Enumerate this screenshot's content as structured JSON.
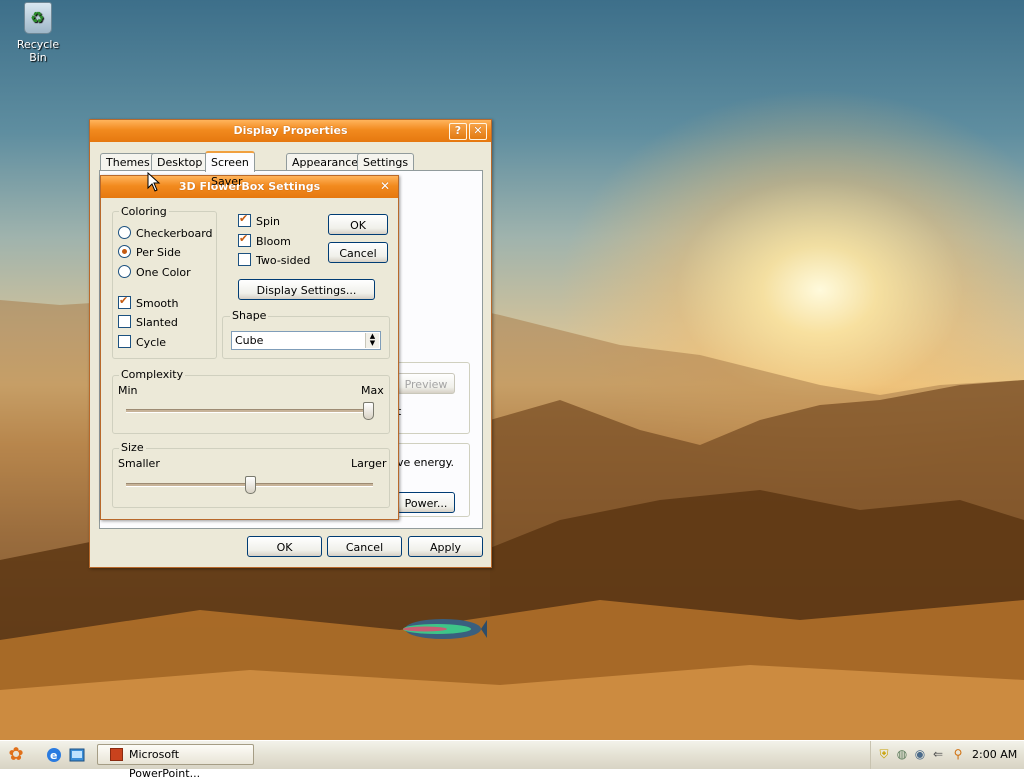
{
  "desktop": {
    "icons": [
      {
        "label": "Recycle Bin"
      }
    ]
  },
  "display_properties": {
    "title": "Display Properties",
    "tabs": [
      {
        "label": "Themes"
      },
      {
        "label": "Desktop"
      },
      {
        "label": "Screen Saver",
        "active": true
      },
      {
        "label": "Appearance"
      },
      {
        "label": "Settings"
      }
    ],
    "partial_preview_label": "Preview",
    "partial_text_energy": "ve energy.",
    "partial_text_t": "t",
    "power_button": "Power...",
    "ok": "OK",
    "cancel": "Cancel",
    "apply": "Apply"
  },
  "flowerbox": {
    "title": "3D FlowerBox Settings",
    "coloring": {
      "label": "Coloring",
      "options": [
        {
          "label": "Checkerboard",
          "selected": false
        },
        {
          "label": "Per Side",
          "selected": true
        },
        {
          "label": "One Color",
          "selected": false
        }
      ],
      "checks": [
        {
          "label": "Smooth",
          "checked": true
        },
        {
          "label": "Slanted",
          "checked": false
        },
        {
          "label": "Cycle",
          "checked": false
        }
      ]
    },
    "right_checks": [
      {
        "label": "Spin",
        "checked": true
      },
      {
        "label": "Bloom",
        "checked": true
      },
      {
        "label": "Two-sided",
        "checked": false
      }
    ],
    "ok": "OK",
    "cancel": "Cancel",
    "display_settings": "Display Settings...",
    "shape": {
      "label": "Shape",
      "value": "Cube"
    },
    "complexity": {
      "label": "Complexity",
      "min": "Min",
      "max": "Max",
      "level": 1.0
    },
    "size": {
      "label": "Size",
      "min": "Smaller",
      "max": "Larger",
      "level": 0.5
    }
  },
  "taskbar": {
    "task_buttons": [
      {
        "label": "Microsoft PowerPoint..."
      }
    ],
    "clock": "2:00 AM"
  }
}
